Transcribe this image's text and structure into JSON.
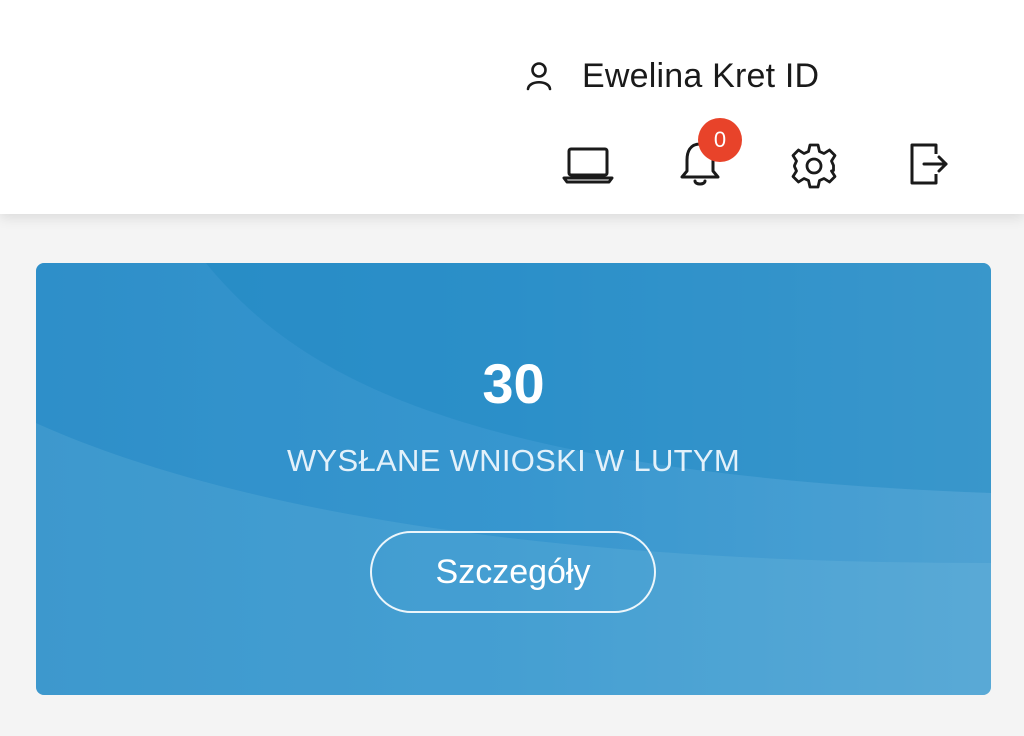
{
  "header": {
    "user": {
      "name": "Ewelina Kret ID",
      "icon": "user-icon"
    },
    "icons": [
      {
        "name": "laptop-icon"
      },
      {
        "name": "bell-icon"
      },
      {
        "name": "gear-icon"
      },
      {
        "name": "logout-icon"
      }
    ],
    "notifications": {
      "count": "0",
      "badge_color": "#e8432a"
    }
  },
  "summary_card": {
    "value": "30",
    "label": "WYSŁANE WNIOSKI W LUTYM",
    "button_label": "Szczegóły",
    "color": "#3b9ad0"
  }
}
